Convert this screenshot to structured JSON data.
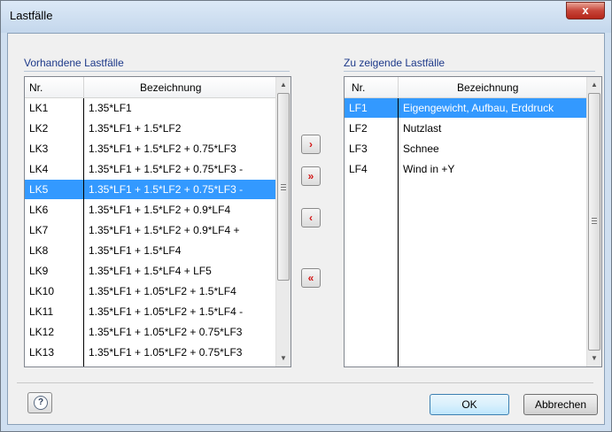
{
  "window": {
    "title": "Lastfälle",
    "close_label": "x"
  },
  "left_group": {
    "label": "Vorhandene Lastfälle",
    "columns": [
      "Nr.",
      "Bezeichnung"
    ],
    "rows": [
      [
        "LK1",
        "1.35*LF1"
      ],
      [
        "LK2",
        "1.35*LF1 + 1.5*LF2"
      ],
      [
        "LK3",
        "1.35*LF1 + 1.5*LF2 + 0.75*LF3"
      ],
      [
        "LK4",
        "1.35*LF1 + 1.5*LF2 + 0.75*LF3 -"
      ],
      [
        "LK5",
        "1.35*LF1 + 1.5*LF2 + 0.75*LF3 -"
      ],
      [
        "LK6",
        "1.35*LF1 + 1.5*LF2 + 0.9*LF4"
      ],
      [
        "LK7",
        "1.35*LF1 + 1.5*LF2 + 0.9*LF4 +"
      ],
      [
        "LK8",
        "1.35*LF1 + 1.5*LF4"
      ],
      [
        "LK9",
        "1.35*LF1 + 1.5*LF4 + LF5"
      ],
      [
        "LK10",
        "1.35*LF1 + 1.05*LF2 + 1.5*LF4"
      ],
      [
        "LK11",
        "1.35*LF1 + 1.05*LF2 + 1.5*LF4 -"
      ],
      [
        "LK12",
        "1.35*LF1 + 1.05*LF2 + 0.75*LF3"
      ],
      [
        "LK13",
        "1.35*LF1 + 1.05*LF2 + 0.75*LF3"
      ]
    ],
    "selected_row": 4
  },
  "right_group": {
    "label": "Zu zeigende Lastfälle",
    "columns": [
      "Nr.",
      "Bezeichnung"
    ],
    "rows": [
      [
        "LF1",
        "Eigengewicht, Aufbau, Erddruck"
      ],
      [
        "LF2",
        "Nutzlast"
      ],
      [
        "LF3",
        "Schnee"
      ],
      [
        "LF4",
        "Wind in +Y"
      ]
    ],
    "selected_row": 0
  },
  "transfer_buttons": {
    "add_one": "›",
    "add_all": "»",
    "remove_one": "‹",
    "remove_all": "«"
  },
  "footer": {
    "help_icon_label": "?",
    "ok_label": "OK",
    "cancel_label": "Abbrechen"
  },
  "colors": {
    "selection": "#3399ff",
    "arrow_icons": "#d31515",
    "group_label": "#1e3a8a"
  }
}
